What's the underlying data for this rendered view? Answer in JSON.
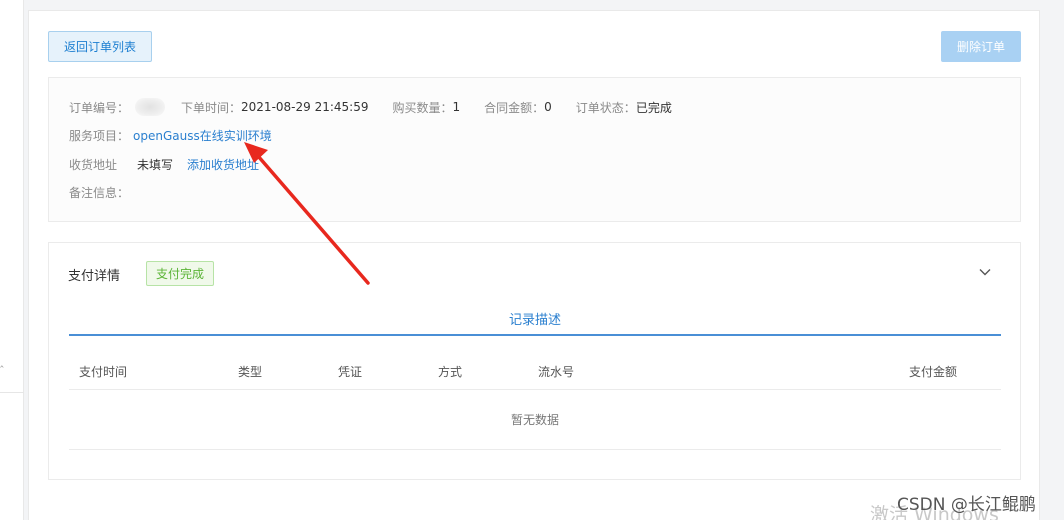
{
  "actions": {
    "back_label": "返回订单列表",
    "delete_label": "删除订单"
  },
  "order": {
    "id_label": "订单编号：",
    "time_label": "下单时间：",
    "time_value": "2021-08-29 21:45:59",
    "qty_label": "购买数量：",
    "qty_value": "1",
    "amount_label": "合同金额：",
    "amount_value": "0",
    "status_label": "订单状态：",
    "status_value": "已完成",
    "service_label": "服务项目：",
    "service_value": "openGauss在线实训环境",
    "address_label": "收货地址",
    "address_value": "未填写",
    "add_address_label": "添加收货地址",
    "note_label": "备注信息："
  },
  "payment": {
    "title": "支付详情",
    "badge": "支付完成",
    "tab_label": "记录描述",
    "columns": [
      "支付时间",
      "类型",
      "凭证",
      "方式",
      "流水号",
      "支付金额"
    ],
    "empty_text": "暂无数据"
  },
  "colors": {
    "accent": "#2a7fcf",
    "success": "#5bb437",
    "annotation_arrow": "#e8281e"
  },
  "watermark": {
    "os": "激活 Windows",
    "csdn": "CSDN @长江鲲鹏"
  }
}
